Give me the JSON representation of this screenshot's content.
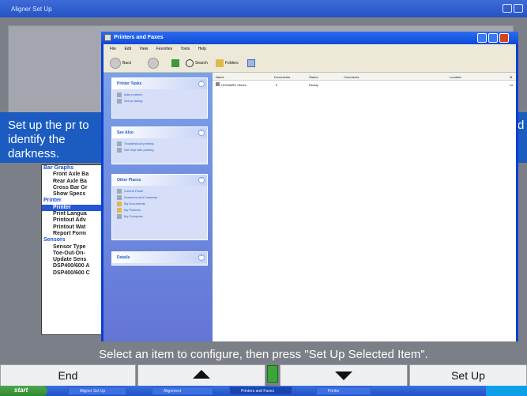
{
  "app": {
    "title": "Aligner Set Up",
    "instruction": "Set up the pr to identify the darkness.",
    "instruction_right": "d",
    "bottom_prompt": "Select an item to configure, then press \"Set Up Selected Item\".",
    "buttons": {
      "end": "End",
      "setup": "Set Up"
    },
    "tree": [
      {
        "label": "Bar Graphs",
        "group": true
      },
      {
        "label": "Front Axle Ba"
      },
      {
        "label": "Rear Axle Ba"
      },
      {
        "label": "Cross Bar Gr"
      },
      {
        "label": "Show Specs"
      },
      {
        "label": "Printer",
        "group": true
      },
      {
        "label": "Printer",
        "selected": true
      },
      {
        "label": "Print Langua"
      },
      {
        "label": "Printout Adv"
      },
      {
        "label": "Printout Wat"
      },
      {
        "label": "Report Form"
      },
      {
        "label": "Sensors",
        "group": true
      },
      {
        "label": "Sensor Type"
      },
      {
        "label": "Toe-Out-On-"
      },
      {
        "label": "Update Sens"
      },
      {
        "label": "DSP400/600 A"
      },
      {
        "label": "DSP400/600 C"
      }
    ]
  },
  "taskbar": {
    "start": "start",
    "items": [
      "Aligner Set Up",
      "Alignment",
      "Printers and Faxes",
      "Printer"
    ]
  },
  "printers_window": {
    "title": "Printers and Faxes",
    "menu": [
      "File",
      "Edit",
      "View",
      "Favorites",
      "Tools",
      "Help"
    ],
    "toolbar": {
      "back": "Back",
      "search": "Search",
      "folders": "Folders"
    },
    "tasks_panel": {
      "heading": "Printer Tasks",
      "items": [
        "Add a printer",
        "Set up faxing"
      ]
    },
    "see_also_panel": {
      "heading": "See Also",
      "items": [
        "Troubleshoot printing",
        "Get help with printing"
      ]
    },
    "other_places_panel": {
      "heading": "Other Places",
      "items": [
        "Control Panel",
        "Scanners and Cameras",
        "My Documents",
        "My Pictures",
        "My Computer"
      ]
    },
    "details_panel": {
      "heading": "Details"
    },
    "columns": [
      "Name",
      "Documents",
      "Status",
      "Comments",
      "Location",
      "M"
    ],
    "rows": [
      {
        "name": "LEXMARK Series",
        "documents": "0",
        "status": "Ready",
        "comments": "",
        "location": "",
        "model": "Le"
      }
    ]
  },
  "colors": {
    "xp_blue": "#0a3fd0",
    "band_blue": "#1c5cc0",
    "panel_link": "#215dc6"
  }
}
